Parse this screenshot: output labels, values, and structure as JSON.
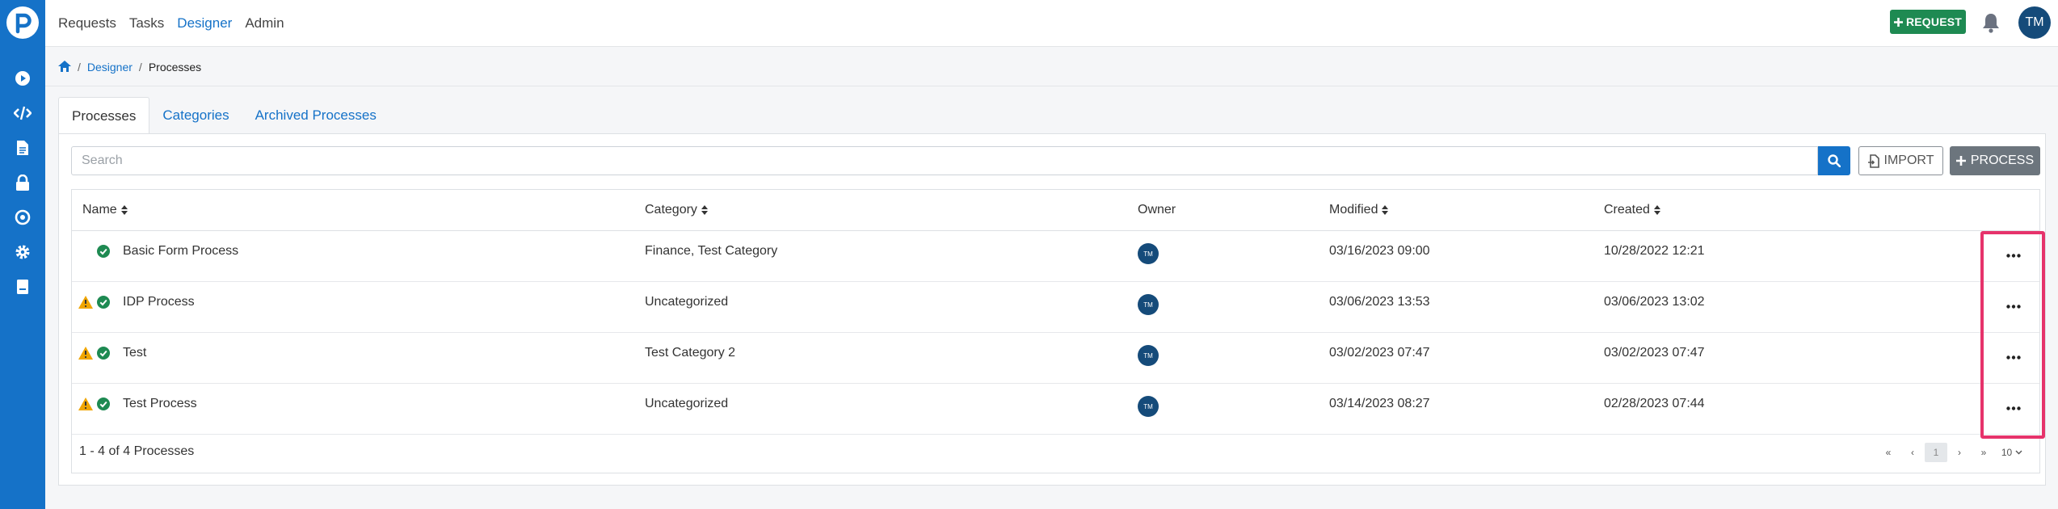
{
  "topnav": {
    "items": [
      "Requests",
      "Tasks",
      "Designer",
      "Admin"
    ],
    "active": "Designer"
  },
  "request_button": "REQUEST",
  "user_initials": "TM",
  "breadcrumb": {
    "designer": "Designer",
    "current": "Processes"
  },
  "tabs": [
    "Processes",
    "Categories",
    "Archived Processes"
  ],
  "search": {
    "placeholder": "Search",
    "value": ""
  },
  "import_button": "IMPORT",
  "process_button": "PROCESS",
  "table": {
    "headers": {
      "name": "Name",
      "category": "Category",
      "owner": "Owner",
      "modified": "Modified",
      "created": "Created"
    },
    "rows": [
      {
        "name": "Basic Form Process",
        "category": "Finance, Test Category",
        "owner": "TM",
        "modified": "03/16/2023 09:00",
        "created": "10/28/2022 12:21",
        "warning": false
      },
      {
        "name": "IDP Process",
        "category": "Uncategorized",
        "owner": "TM",
        "modified": "03/06/2023 13:53",
        "created": "03/06/2023 13:02",
        "warning": true
      },
      {
        "name": "Test",
        "category": "Test Category 2",
        "owner": "TM",
        "modified": "03/02/2023 07:47",
        "created": "03/02/2023 07:47",
        "warning": true
      },
      {
        "name": "Test Process",
        "category": "Uncategorized",
        "owner": "TM",
        "modified": "03/14/2023 08:27",
        "created": "02/28/2023 07:44",
        "warning": true
      }
    ]
  },
  "footer": {
    "summary": "1 - 4 of 4 Processes"
  },
  "pagination": {
    "first": "«",
    "prev": "‹",
    "current": "1",
    "next": "›",
    "last": "»",
    "per_page": "10"
  },
  "colors": {
    "brand": "#1572c8",
    "success": "#1e8a52",
    "warning": "#f0a500",
    "highlight": "#e6336b",
    "avatar": "#154b7a"
  }
}
